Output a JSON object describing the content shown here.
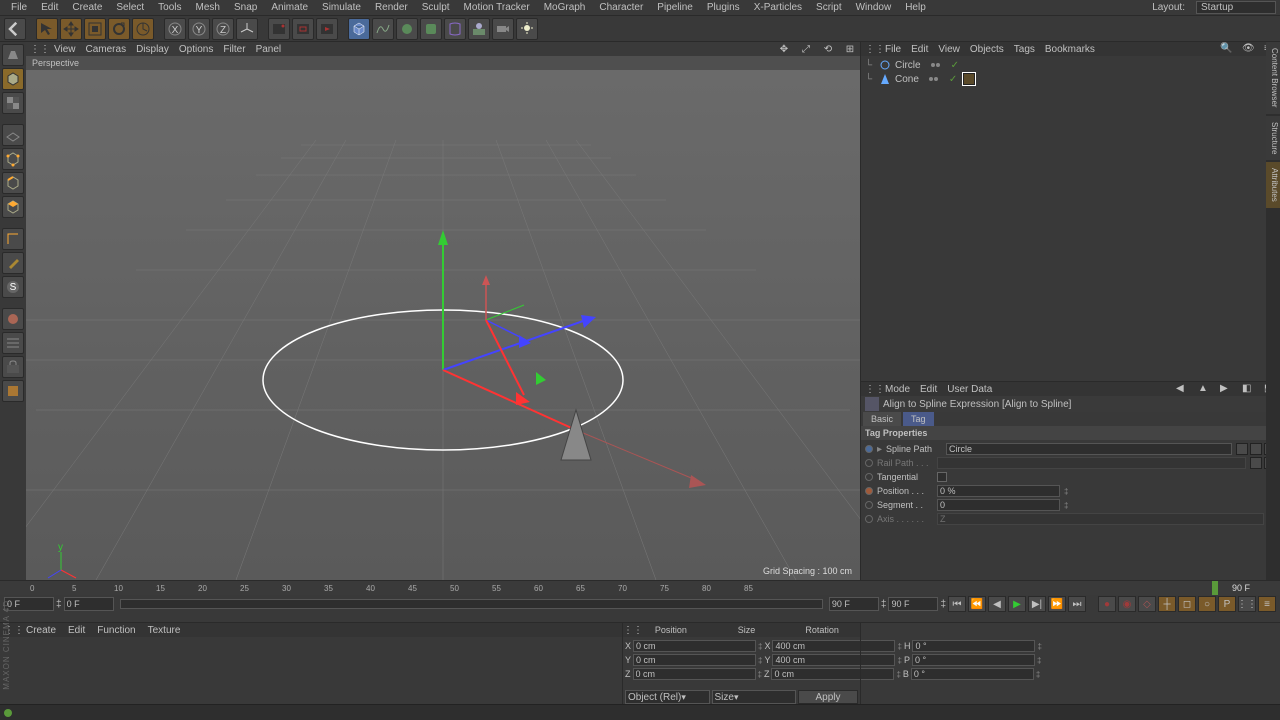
{
  "layout": {
    "label": "Layout:",
    "value": "Startup"
  },
  "menubar": [
    "File",
    "Edit",
    "Create",
    "Select",
    "Tools",
    "Mesh",
    "Snap",
    "Animate",
    "Simulate",
    "Render",
    "Sculpt",
    "Motion Tracker",
    "MoGraph",
    "Character",
    "Pipeline",
    "Plugins",
    "X-Particles",
    "Script",
    "Window",
    "Help"
  ],
  "viewport_menu": [
    "View",
    "Cameras",
    "Display",
    "Options",
    "Filter",
    "Panel"
  ],
  "viewport_title": "Perspective",
  "grid_spacing": "Grid Spacing : 100 cm",
  "obj_menubar": [
    "File",
    "Edit",
    "View",
    "Objects",
    "Tags",
    "Bookmarks"
  ],
  "obj_tree": [
    {
      "name": "Circle",
      "icon": "circle"
    },
    {
      "name": "Cone",
      "icon": "cone"
    }
  ],
  "attr_menubar": [
    "Mode",
    "Edit",
    "User Data"
  ],
  "attr_header": "Align to Spline Expression [Align to Spline]",
  "attr_tabs": [
    {
      "label": "Basic",
      "active": false
    },
    {
      "label": "Tag",
      "active": true
    }
  ],
  "attr_section": "Tag Properties",
  "attr_rows": {
    "spline_path": {
      "label": "Spline Path",
      "value": "Circle"
    },
    "rail_path": {
      "label": "Rail Path . . .",
      "value": ""
    },
    "tangential": {
      "label": "Tangential"
    },
    "position": {
      "label": "Position . . .",
      "value": "0 %"
    },
    "segment": {
      "label": "Segment . .",
      "value": "0"
    },
    "axis": {
      "label": "Axis . . . . . .",
      "value": "Z"
    }
  },
  "timeline": {
    "ticks": [
      "0",
      "5",
      "10",
      "15",
      "20",
      "25",
      "30",
      "35",
      "40",
      "45",
      "50",
      "55",
      "60",
      "65",
      "70",
      "75",
      "80",
      "85"
    ],
    "end_label": "90 F",
    "start_field": "0 F",
    "end_field": "90 F",
    "cur_field_left": "0 F",
    "cur_field_right": "90 F"
  },
  "bottom_menu": [
    "Create",
    "Edit",
    "Function",
    "Texture"
  ],
  "coord": {
    "headers": [
      "Position",
      "Size",
      "Rotation"
    ],
    "rows": [
      {
        "axis": "X",
        "pos": "0 cm",
        "size": "400 cm",
        "rot_label": "H",
        "rot": "0 °"
      },
      {
        "axis": "Y",
        "pos": "0 cm",
        "size": "400 cm",
        "rot_label": "P",
        "rot": "0 °"
      },
      {
        "axis": "Z",
        "pos": "0 cm",
        "size": "0 cm",
        "rot_label": "B",
        "rot": "0 °"
      }
    ],
    "selectors": [
      "Object (Rel)",
      "Size"
    ],
    "apply": "Apply"
  },
  "brand": "MAXON CINEMA 4D"
}
